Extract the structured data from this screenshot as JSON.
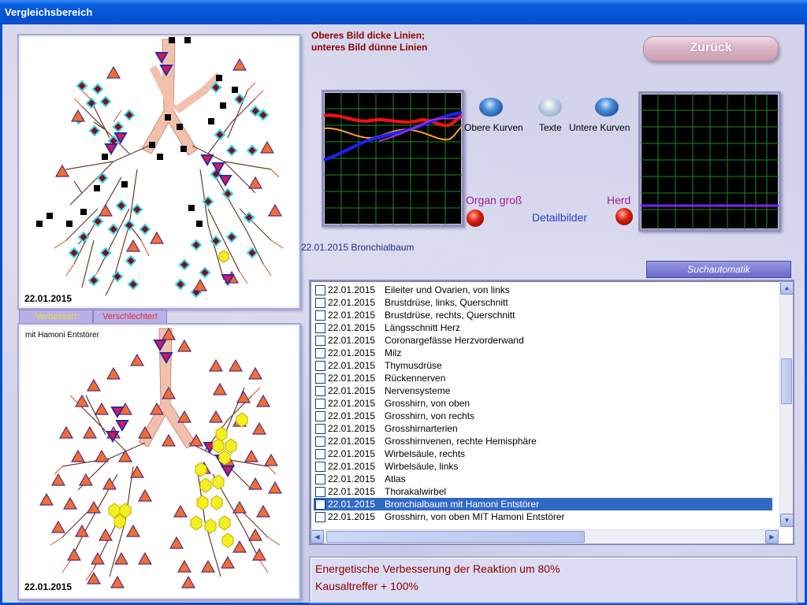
{
  "window": {
    "title": "Vergleichsbereich"
  },
  "top_panel": {
    "date": "22.01.2015"
  },
  "bottom_panel": {
    "date": "22.01.2015",
    "note": "mit Hamoni Entstörer"
  },
  "tabs": {
    "improved": "Verbessert",
    "worsened": "Verschlechtert"
  },
  "heading": {
    "line1": "Oberes Bild dicke Linien;",
    "line2": "unteres Bild dünne Linien"
  },
  "back_button": "Zurück",
  "orbs": {
    "upper": "Obere Kurven",
    "texts": "Texte",
    "lower": "Untere Kurven"
  },
  "labels": {
    "organ": "Organ groß",
    "detail": "Detailbilder",
    "focus": "Herd"
  },
  "caption": "22.01.2015 Bronchialbaum",
  "search_button": "Suchautomatik",
  "list": [
    {
      "date": "22.01.2015",
      "name": "Eileiter und Ovarien, von links"
    },
    {
      "date": "22.01.2015",
      "name": "Brustdrüse, links, Querschnitt"
    },
    {
      "date": "22.01.2015",
      "name": "Brustdrüse, rechts, Querschnitt"
    },
    {
      "date": "22.01.2015",
      "name": "Längsschnitt Herz"
    },
    {
      "date": "22.01.2015",
      "name": "Coronargefässe Herzvorderwand"
    },
    {
      "date": "22.01.2015",
      "name": "Milz"
    },
    {
      "date": "22.01.2015",
      "name": "Thymusdrüse"
    },
    {
      "date": "22.01.2015",
      "name": "Rückennerven"
    },
    {
      "date": "22.01.2015",
      "name": "Nervensysteme"
    },
    {
      "date": "22.01.2015",
      "name": "Grosshirn, von oben"
    },
    {
      "date": "22.01.2015",
      "name": "Grosshirn, von rechts"
    },
    {
      "date": "22.01.2015",
      "name": "Grosshirnarterien"
    },
    {
      "date": "22.01.2015",
      "name": "Grosshirnvenen, rechte Hemisphäre"
    },
    {
      "date": "22.01.2015",
      "name": "Wirbelsäule, rechts"
    },
    {
      "date": "22.01.2015",
      "name": "Wirbelsäule, links"
    },
    {
      "date": "22.01.2015",
      "name": "Atlas"
    },
    {
      "date": "22.01.2015",
      "name": "Thorakalwirbel"
    },
    {
      "date": "22.01.2015",
      "name": "Bronchialbaum  mit Hamoni Entstörer"
    },
    {
      "date": "22.01.2015",
      "name": "Grosshirn, von oben  MIT Hamoni Entstörer"
    }
  ],
  "selected_row": 17,
  "result": {
    "line1": "Energetische Verbesserung der Reaktion um 80%",
    "line2": "Kausaltreffer + 100%"
  },
  "colors": {
    "titlebar": "#0453d6",
    "heading": "#8b0000",
    "selection": "#316ac5"
  }
}
